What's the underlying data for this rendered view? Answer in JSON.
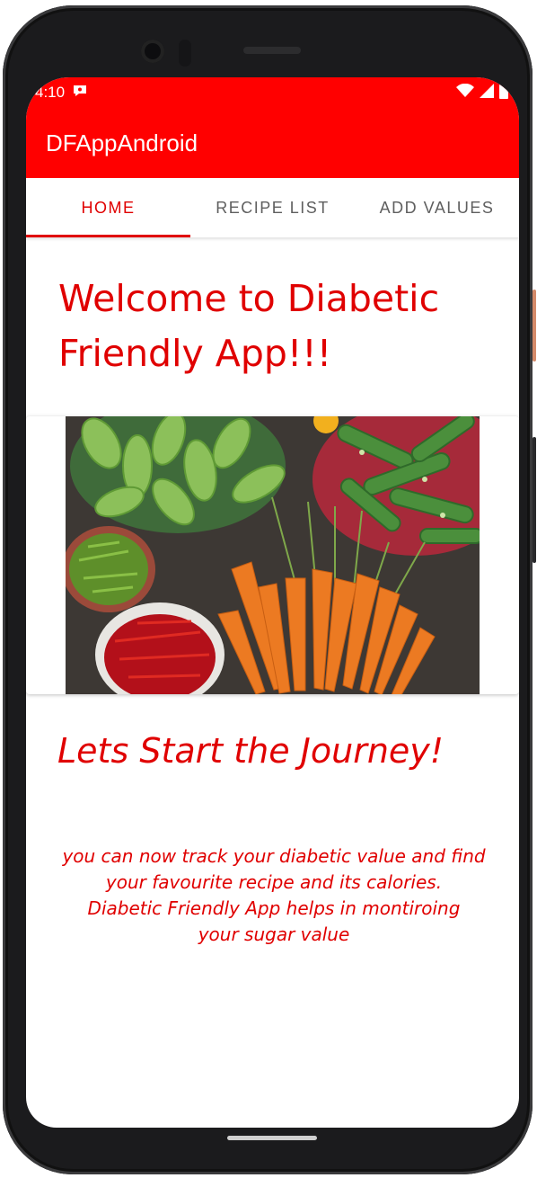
{
  "status_bar": {
    "time": "4:10",
    "icons": [
      "notification-icon",
      "wifi-icon",
      "signal-icon",
      "battery-icon"
    ]
  },
  "app_bar": {
    "title": "DFAppAndroid"
  },
  "tabs": [
    {
      "label": "HOME",
      "active": true
    },
    {
      "label": "RECIPE LIST",
      "active": false
    },
    {
      "label": "ADD VALUES",
      "active": false
    }
  ],
  "home": {
    "welcome_line1": "Welcome to Diabetic",
    "welcome_line2": "Friendly App!!!",
    "journey_title": "Lets Start the Journey!",
    "description_line1": "you can now track your diabetic value and find",
    "description_line2": "your favourite recipe and its calories.",
    "description_line3": "Diabetic Friendly App helps in montiroing",
    "description_line4": "your sugar value"
  },
  "colors": {
    "primary": "#ff0000",
    "accent": "#e00000",
    "tab_inactive": "#5f5f5f"
  }
}
